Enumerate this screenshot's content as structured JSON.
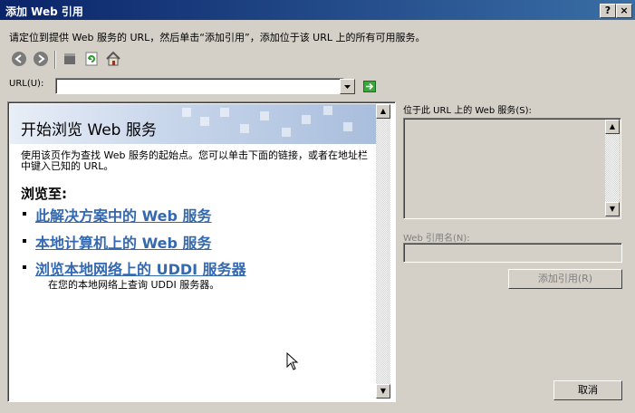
{
  "window": {
    "title": "添加 Web 引用",
    "help_glyph": "?",
    "close_glyph": "×"
  },
  "instruction": "请定位到提供 Web 服务的 URL，然后单击“添加引用”，添加位于该 URL 上的所有可用服务。",
  "toolbar": {
    "icons": [
      "back-icon",
      "forward-icon",
      "stop-icon",
      "refresh-icon",
      "home-icon"
    ]
  },
  "url_bar": {
    "label": "URL(U):",
    "value": ""
  },
  "browser_page": {
    "title": "开始浏览 Web 服务",
    "intro": "使用该页作为查找 Web 服务的起始点。您可以单击下面的链接，或者在地址栏中键入已知的 URL。",
    "browse_heading": "浏览至:",
    "links": [
      "此解决方案中的 Web 服务",
      "本地计算机上的 Web 服务",
      "浏览本地网络上的 UDDI 服务器"
    ],
    "link_subtext": "在您的本地网络上查询 UDDI 服务器。"
  },
  "right_panel": {
    "services_label": "位于此 URL 上的 Web 服务(S):",
    "services": [],
    "ref_name_label": "Web 引用名(N):",
    "ref_name_value": "",
    "add_ref_button": "添加引用(R)",
    "cancel_button": "取消"
  },
  "colors": {
    "title_bar": "#0a246a",
    "link": "#3469b0",
    "dialog_bg": "#d4d0c8"
  }
}
